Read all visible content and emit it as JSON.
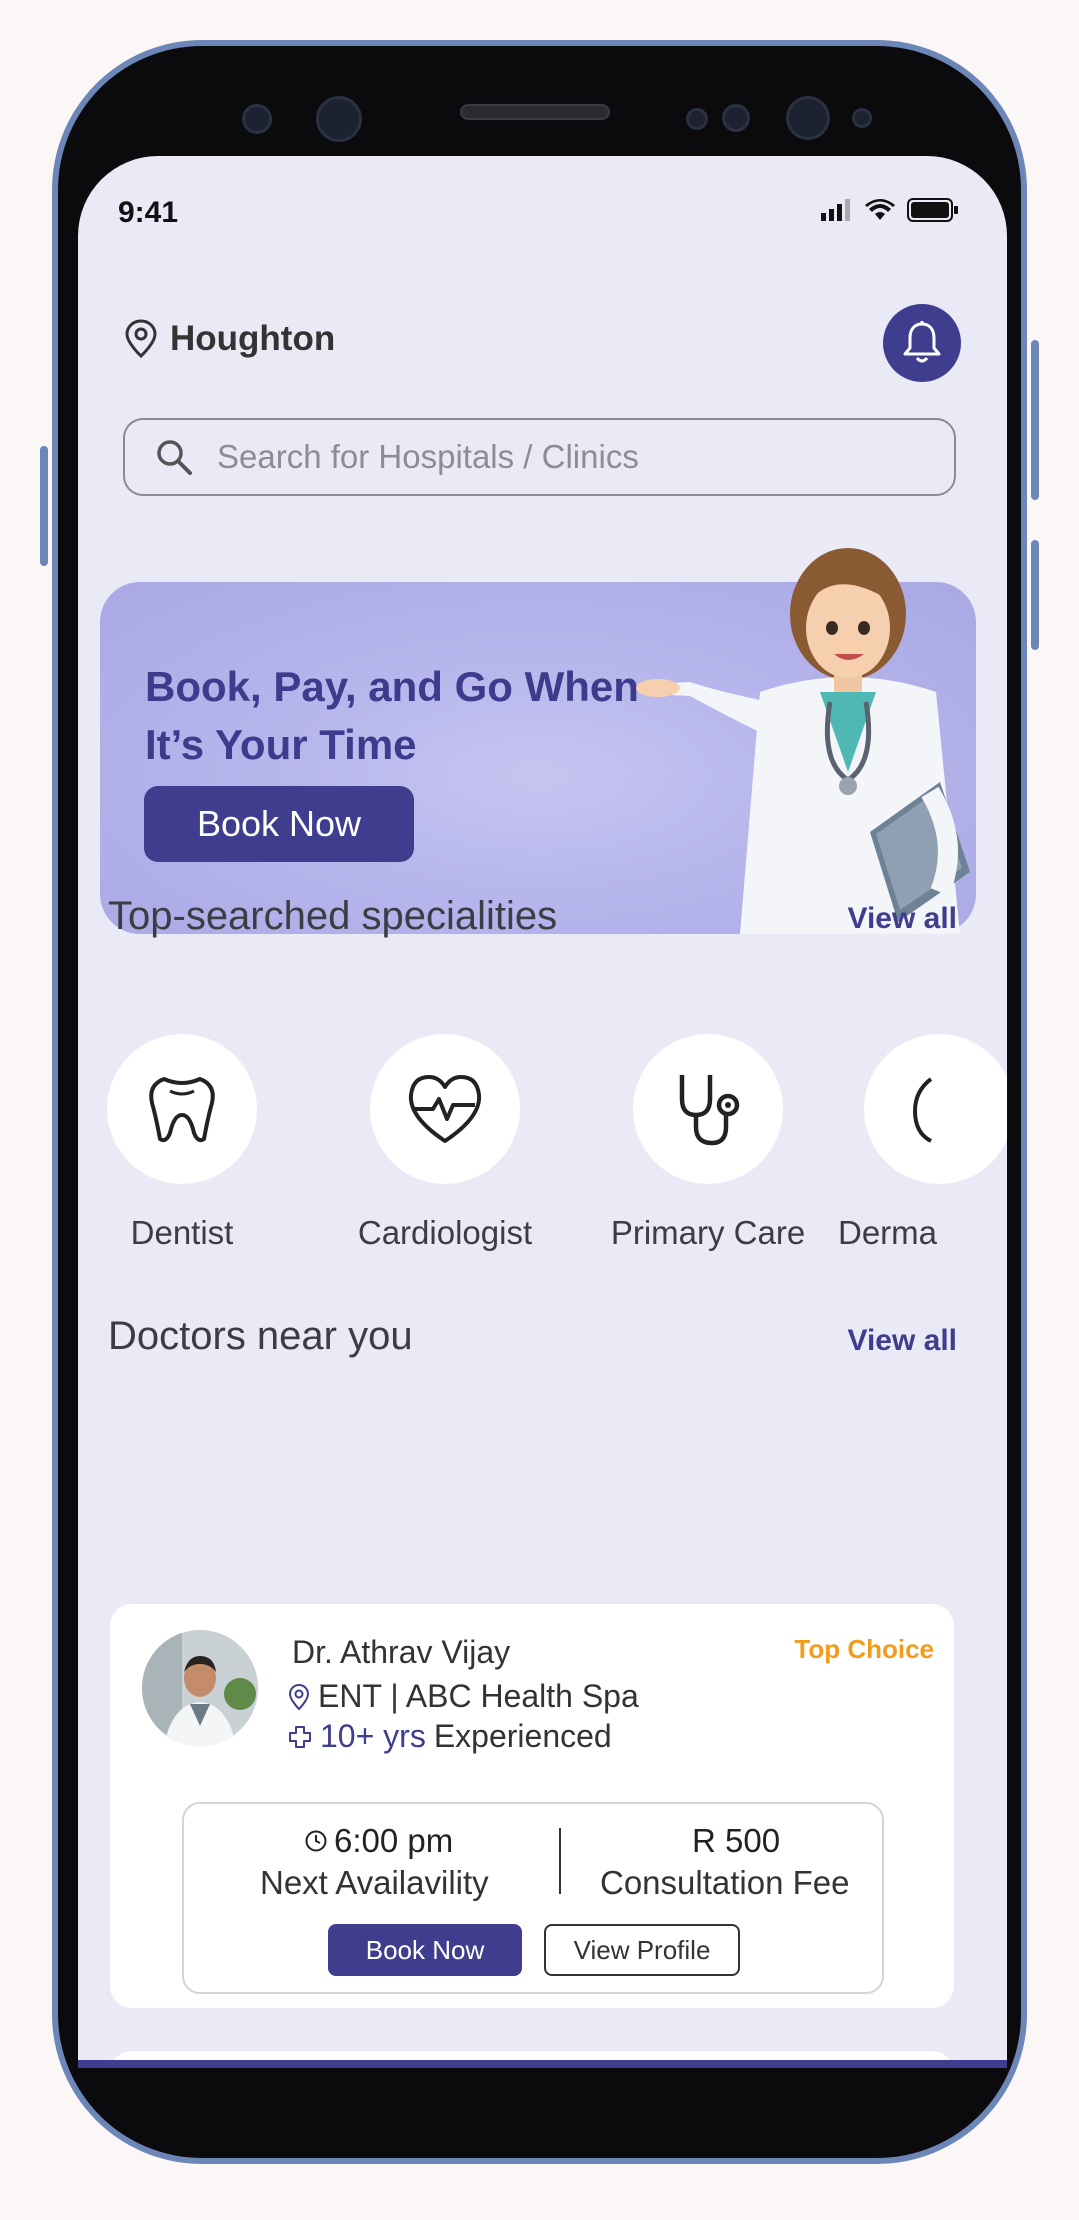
{
  "status_bar": {
    "time": "9:41"
  },
  "header": {
    "location": "Houghton"
  },
  "search": {
    "placeholder": "Search for Hospitals / Clinics"
  },
  "banner": {
    "title": "Book, Pay, and Go When It’s Your Time",
    "button": "Book Now"
  },
  "specialities": {
    "title": "Top-searched specialities",
    "view_all": "View all",
    "items": [
      {
        "label": "Dentist",
        "icon": "tooth-icon"
      },
      {
        "label": "Cardiologist",
        "icon": "heart-pulse-icon"
      },
      {
        "label": "Primary Care",
        "icon": "stethoscope-icon"
      },
      {
        "label": "Derma",
        "icon": "derma-icon"
      }
    ]
  },
  "doctors": {
    "title": "Doctors near you",
    "view_all": "View all",
    "cards": [
      {
        "name": "Dr. Athrav Vijay",
        "badge": "Top Choice",
        "specialty_location": "ENT | ABC Health Spa",
        "experience_years": "10+ yrs",
        "experience_suffix": "Experienced",
        "next_time": "6:00 pm",
        "next_label": "Next Availavility",
        "fee": "R 500",
        "fee_label": "Consultation Fee",
        "book_label": "Book Now",
        "view_label": "View Profile"
      }
    ]
  },
  "colors": {
    "primary": "#3f3d8e",
    "background": "#eae9f6",
    "badge": "#f39c1b",
    "banner": "#b6b5ec"
  }
}
